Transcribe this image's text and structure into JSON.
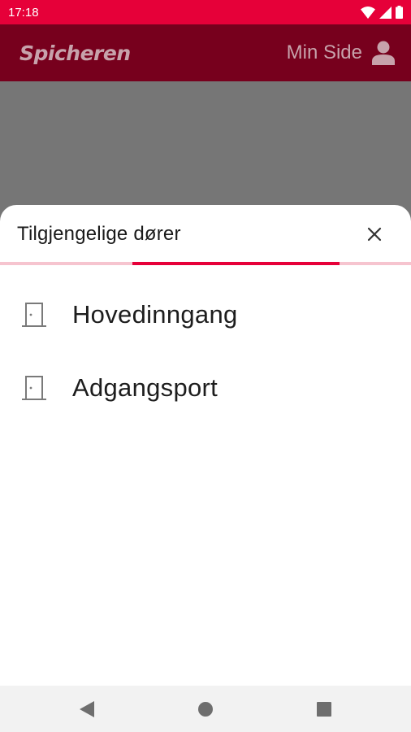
{
  "status_bar": {
    "time": "17:18",
    "icons": [
      "wifi-icon",
      "cellular-signal-icon",
      "battery-icon"
    ]
  },
  "app_bar": {
    "brand": "Spicheren",
    "min_side_label": "Min Side",
    "icon": "person-icon"
  },
  "sheet": {
    "title": "Tilgjengelige dører",
    "close_icon": "close-icon",
    "doors": [
      {
        "label": "Hovedinngang",
        "icon": "door-icon"
      },
      {
        "label": "Adgangsport",
        "icon": "door-icon"
      }
    ]
  },
  "nav_bar": {
    "buttons": [
      "back-icon",
      "home-icon",
      "recents-icon"
    ]
  },
  "colors": {
    "status_bar": "#e60039",
    "app_bar": "#77001d",
    "accent": "#e60039",
    "accent_light": "#f6c4cf",
    "backdrop": "#767676",
    "app_bar_text": "#c7a2ab"
  }
}
